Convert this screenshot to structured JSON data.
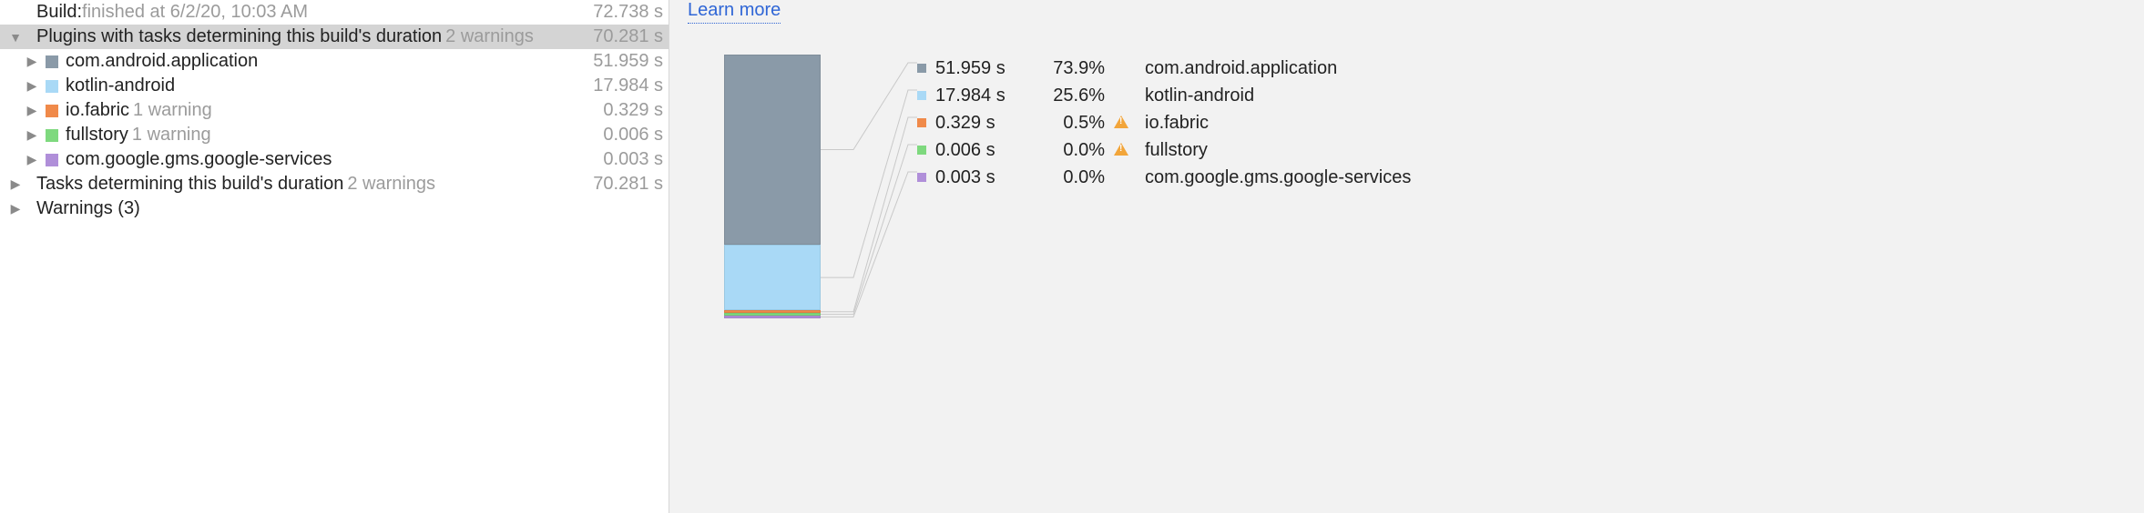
{
  "learn_more": "Learn more",
  "tree": {
    "build": {
      "prefix": "Build: ",
      "status": "finished at 6/2/20, 10:03 AM",
      "time": "72.738 s"
    },
    "plugins_heading": {
      "label": "Plugins with tasks determining this build's duration",
      "warnings": "2 warnings",
      "time": "70.281 s"
    },
    "plugins": [
      {
        "name": "com.android.application",
        "color": "#8a9aa8",
        "time": "51.959 s",
        "warning": ""
      },
      {
        "name": "kotlin-android",
        "color": "#a9d9f6",
        "time": "17.984 s",
        "warning": ""
      },
      {
        "name": "io.fabric",
        "color": "#f08a4a",
        "time": "0.329 s",
        "warning": "1 warning"
      },
      {
        "name": "fullstory",
        "color": "#7ed97e",
        "time": "0.006 s",
        "warning": "1 warning"
      },
      {
        "name": "com.google.gms.google-services",
        "color": "#b08fd9",
        "time": "0.003 s",
        "warning": ""
      }
    ],
    "tasks_heading": {
      "label": "Tasks determining this build's duration",
      "warnings": "2 warnings",
      "time": "70.281 s"
    },
    "warnings_heading": {
      "label": "Warnings (3)"
    }
  },
  "chart_data": {
    "type": "bar",
    "title": "",
    "xlabel": "",
    "ylabel": "",
    "categories": [
      "com.android.application",
      "kotlin-android",
      "io.fabric",
      "fullstory",
      "com.google.gms.google-services"
    ],
    "values": [
      51.959,
      17.984,
      0.329,
      0.006,
      0.003
    ],
    "percentages": [
      73.9,
      25.6,
      0.5,
      0.0,
      0.0
    ],
    "colors": [
      "#8a9aa8",
      "#a9d9f6",
      "#f08a4a",
      "#7ed97e",
      "#b08fd9"
    ],
    "has_warning": [
      false,
      false,
      true,
      true,
      false
    ],
    "times_str": [
      "51.959 s",
      "17.984 s",
      "0.329 s",
      "0.006 s",
      "0.003 s"
    ],
    "pct_str": [
      "73.9%",
      "25.6%",
      "0.5%",
      "0.0%",
      "0.0%"
    ]
  }
}
